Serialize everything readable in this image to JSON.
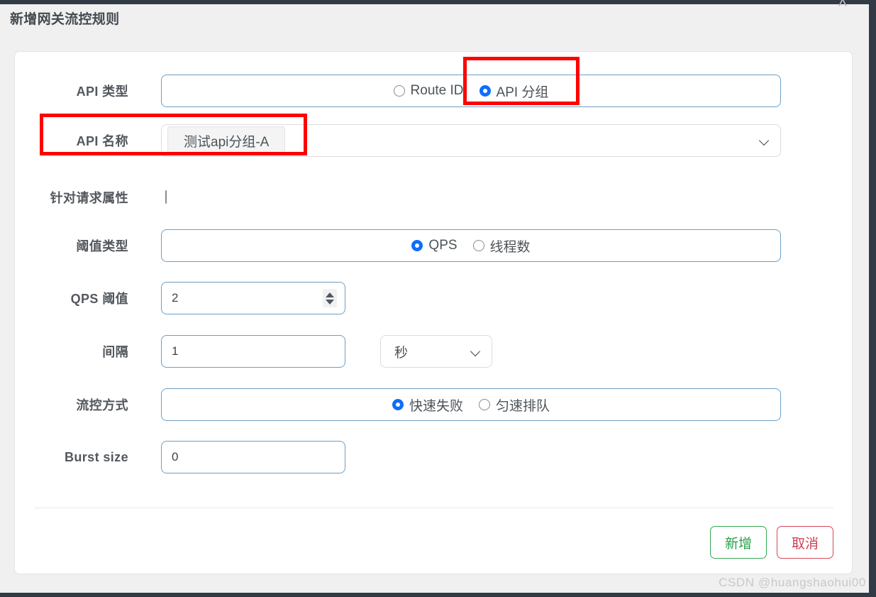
{
  "dialog": {
    "title": "新增网关流控规则",
    "close_icon": "chevron-up-close-icon"
  },
  "form": {
    "rows": [
      {
        "label": "API 类型",
        "type": "radio-group",
        "options": [
          {
            "label": "Route ID",
            "selected": false
          },
          {
            "label": "API 分组",
            "selected": true
          }
        ]
      },
      {
        "label": "API 名称",
        "type": "select",
        "value": "测试api分组-A"
      },
      {
        "label": "针对请求属性",
        "type": "checkbox",
        "checked": false
      },
      {
        "label": "阈值类型",
        "type": "radio-group",
        "options": [
          {
            "label": "QPS",
            "selected": true
          },
          {
            "label": "线程数",
            "selected": false
          }
        ]
      },
      {
        "label": "QPS 阈值",
        "type": "number",
        "value": "2"
      },
      {
        "label": "间隔",
        "type": "number-with-unit",
        "value": "1",
        "unit": "秒"
      },
      {
        "label": "流控方式",
        "type": "radio-group",
        "options": [
          {
            "label": "快速失败",
            "selected": true
          },
          {
            "label": "匀速排队",
            "selected": false
          }
        ]
      },
      {
        "label": "Burst size",
        "type": "number",
        "value": "0"
      }
    ]
  },
  "footer": {
    "create_label": "新增",
    "cancel_label": "取消"
  },
  "annotations": {
    "box_api_group": "API 分组",
    "box_api_name": "API 名称"
  },
  "watermark": "CSDN @huangshaohui00",
  "colors": {
    "accent_blue": "#0d6efd",
    "annotation_red": "#ff0000",
    "create_green": "#2aa04c",
    "cancel_red": "#cf3f52",
    "field_border_blue": "#6d9ec4",
    "dialog_bg": "#f0f0f0"
  }
}
